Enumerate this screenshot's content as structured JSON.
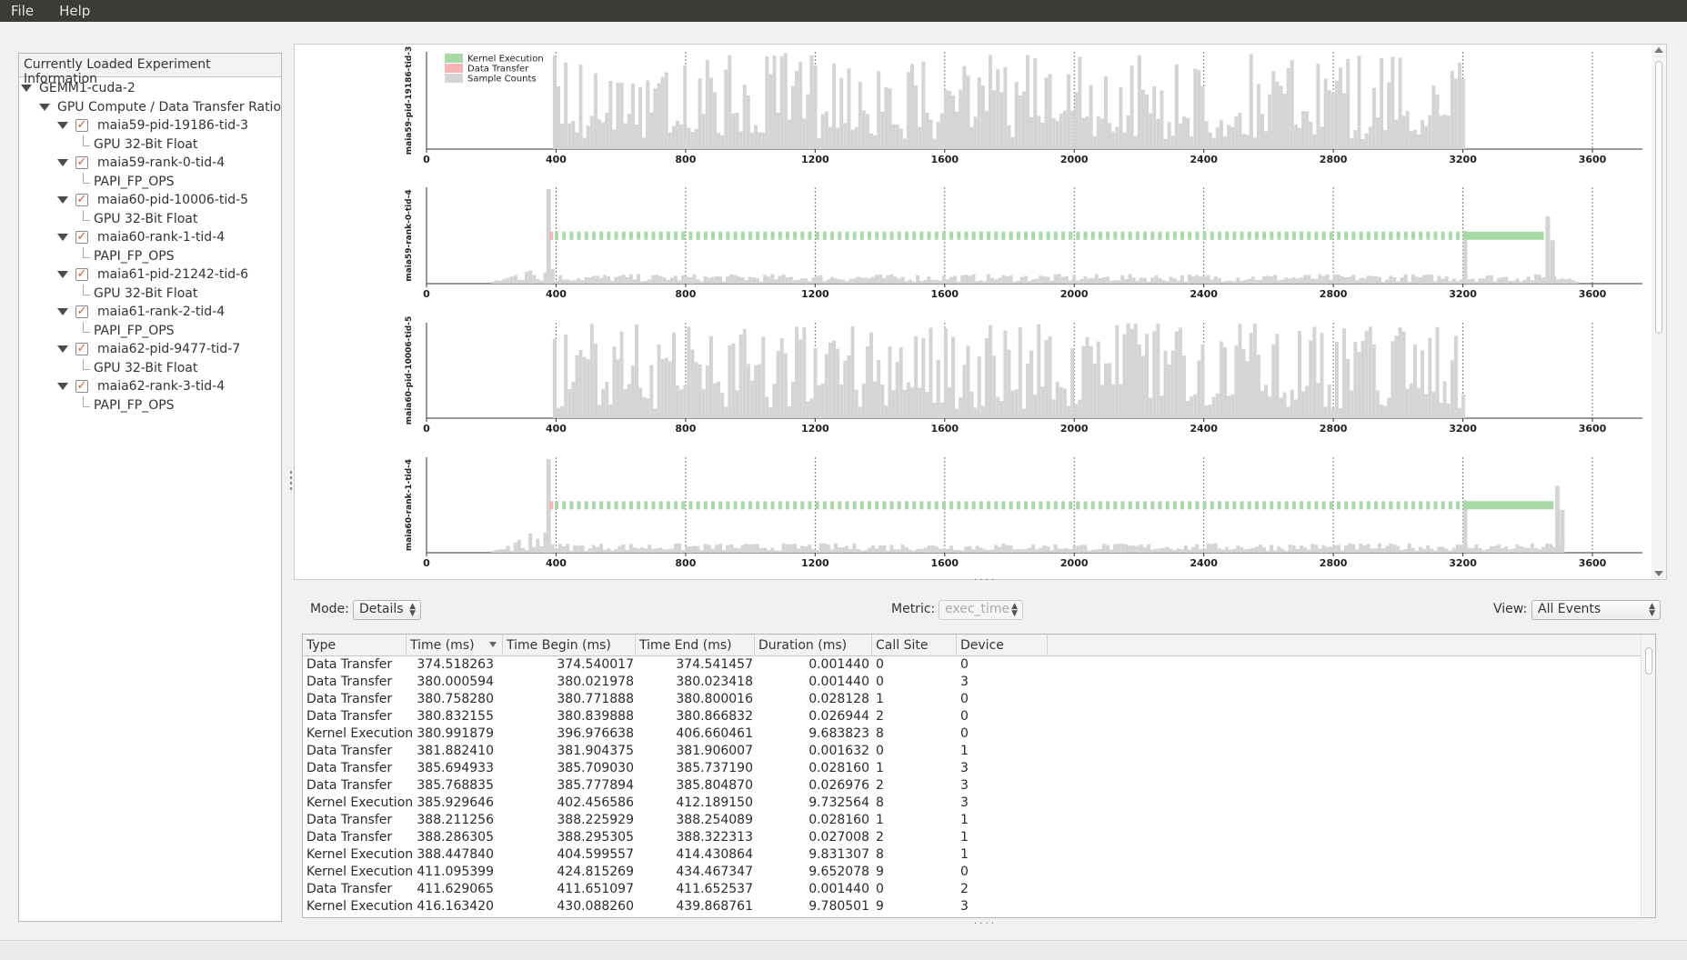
{
  "menu": {
    "file": "File",
    "help": "Help"
  },
  "tree": {
    "header": "Currently Loaded Experiment Information",
    "root": "GEMM1-cuda-2",
    "group": "GPU Compute / Data Transfer Ratio",
    "items": [
      {
        "label": "maia59-pid-19186-tid-3",
        "child": "GPU 32-Bit Float"
      },
      {
        "label": "maia59-rank-0-tid-4",
        "child": "PAPI_FP_OPS"
      },
      {
        "label": "maia60-pid-10006-tid-5",
        "child": "GPU 32-Bit Float"
      },
      {
        "label": "maia60-rank-1-tid-4",
        "child": "PAPI_FP_OPS"
      },
      {
        "label": "maia61-pid-21242-tid-6",
        "child": "GPU 32-Bit Float"
      },
      {
        "label": "maia61-rank-2-tid-4",
        "child": "PAPI_FP_OPS"
      },
      {
        "label": "maia62-pid-9477-tid-7",
        "child": "GPU 32-Bit Float"
      },
      {
        "label": "maia62-rank-3-tid-4",
        "child": "PAPI_FP_OPS"
      }
    ]
  },
  "chart_data": [
    {
      "type": "bar",
      "ylabel": "maia59-pid-19186-tid-3",
      "xlim": [
        0,
        3680
      ],
      "xticks": [
        "0",
        "400",
        "800",
        "1200",
        "1600",
        "2000",
        "2400",
        "2800",
        "3200",
        "3600"
      ],
      "legend": [
        "Kernel Execution",
        "Data Transfer",
        "Sample Counts"
      ],
      "legend_position": "top-left",
      "kernel_segments": [],
      "sample_range": [
        390,
        3200
      ]
    },
    {
      "type": "bar",
      "ylabel": "maia59-rank-0-tid-4",
      "xlim": [
        0,
        3680
      ],
      "xticks": [
        "0",
        "400",
        "800",
        "1200",
        "1600",
        "2000",
        "2400",
        "2800",
        "3200",
        "3600"
      ],
      "kernel_segments": [
        [
          396,
          3200,
          "dotted"
        ],
        [
          3200,
          3450,
          "solid"
        ]
      ],
      "sample_range": [
        200,
        3550
      ]
    },
    {
      "type": "bar",
      "ylabel": "maia60-pid-10006-tid-5",
      "xlim": [
        0,
        3680
      ],
      "xticks": [
        "0",
        "400",
        "800",
        "1200",
        "1600",
        "2000",
        "2400",
        "2800",
        "3200",
        "3600"
      ],
      "kernel_segments": [],
      "sample_range": [
        390,
        3200
      ]
    },
    {
      "type": "bar",
      "ylabel": "maia60-rank-1-tid-4",
      "xlim": [
        0,
        3680
      ],
      "xticks": [
        "0",
        "400",
        "800",
        "1200",
        "1600",
        "2000",
        "2400",
        "2800",
        "3200",
        "3600"
      ],
      "kernel_segments": [
        [
          396,
          3200,
          "dotted"
        ],
        [
          3200,
          3480,
          "solid"
        ]
      ],
      "sample_range": [
        200,
        3500
      ]
    }
  ],
  "colors": {
    "kernel": "#a7dba6",
    "transfer": "#f6b4b4",
    "sample": "#d4d4d4"
  },
  "controls": {
    "mode_label": "Mode:",
    "mode_value": "Details",
    "metric_label": "Metric:",
    "metric_value": "exec_time",
    "view_label": "View:",
    "view_value": "All Events"
  },
  "table": {
    "columns": [
      "Type",
      "Time (ms)",
      "Time Begin (ms)",
      "Time End (ms)",
      "Duration (ms)",
      "Call Site",
      "Device"
    ],
    "rows": [
      [
        "Data Transfer",
        "374.518263",
        "374.540017",
        "374.541457",
        "0.001440",
        "0",
        "0"
      ],
      [
        "Data Transfer",
        "380.000594",
        "380.021978",
        "380.023418",
        "0.001440",
        "0",
        "3"
      ],
      [
        "Data Transfer",
        "380.758280",
        "380.771888",
        "380.800016",
        "0.028128",
        "1",
        "0"
      ],
      [
        "Data Transfer",
        "380.832155",
        "380.839888",
        "380.866832",
        "0.026944",
        "2",
        "0"
      ],
      [
        "Kernel Execution",
        "380.991879",
        "396.976638",
        "406.660461",
        "9.683823",
        "8",
        "0"
      ],
      [
        "Data Transfer",
        "381.882410",
        "381.904375",
        "381.906007",
        "0.001632",
        "0",
        "1"
      ],
      [
        "Data Transfer",
        "385.694933",
        "385.709030",
        "385.737190",
        "0.028160",
        "1",
        "3"
      ],
      [
        "Data Transfer",
        "385.768835",
        "385.777894",
        "385.804870",
        "0.026976",
        "2",
        "3"
      ],
      [
        "Kernel Execution",
        "385.929646",
        "402.456586",
        "412.189150",
        "9.732564",
        "8",
        "3"
      ],
      [
        "Data Transfer",
        "388.211256",
        "388.225929",
        "388.254089",
        "0.028160",
        "1",
        "1"
      ],
      [
        "Data Transfer",
        "388.286305",
        "388.295305",
        "388.322313",
        "0.027008",
        "2",
        "1"
      ],
      [
        "Kernel Execution",
        "388.447840",
        "404.599557",
        "414.430864",
        "9.831307",
        "8",
        "1"
      ],
      [
        "Kernel Execution",
        "411.095399",
        "424.815269",
        "434.467347",
        "9.652078",
        "9",
        "0"
      ],
      [
        "Data Transfer",
        "411.629065",
        "411.651097",
        "411.652537",
        "0.001440",
        "0",
        "2"
      ],
      [
        "Kernel Execution",
        "416.163420",
        "430.088260",
        "439.868761",
        "9.780501",
        "9",
        "3"
      ]
    ]
  }
}
